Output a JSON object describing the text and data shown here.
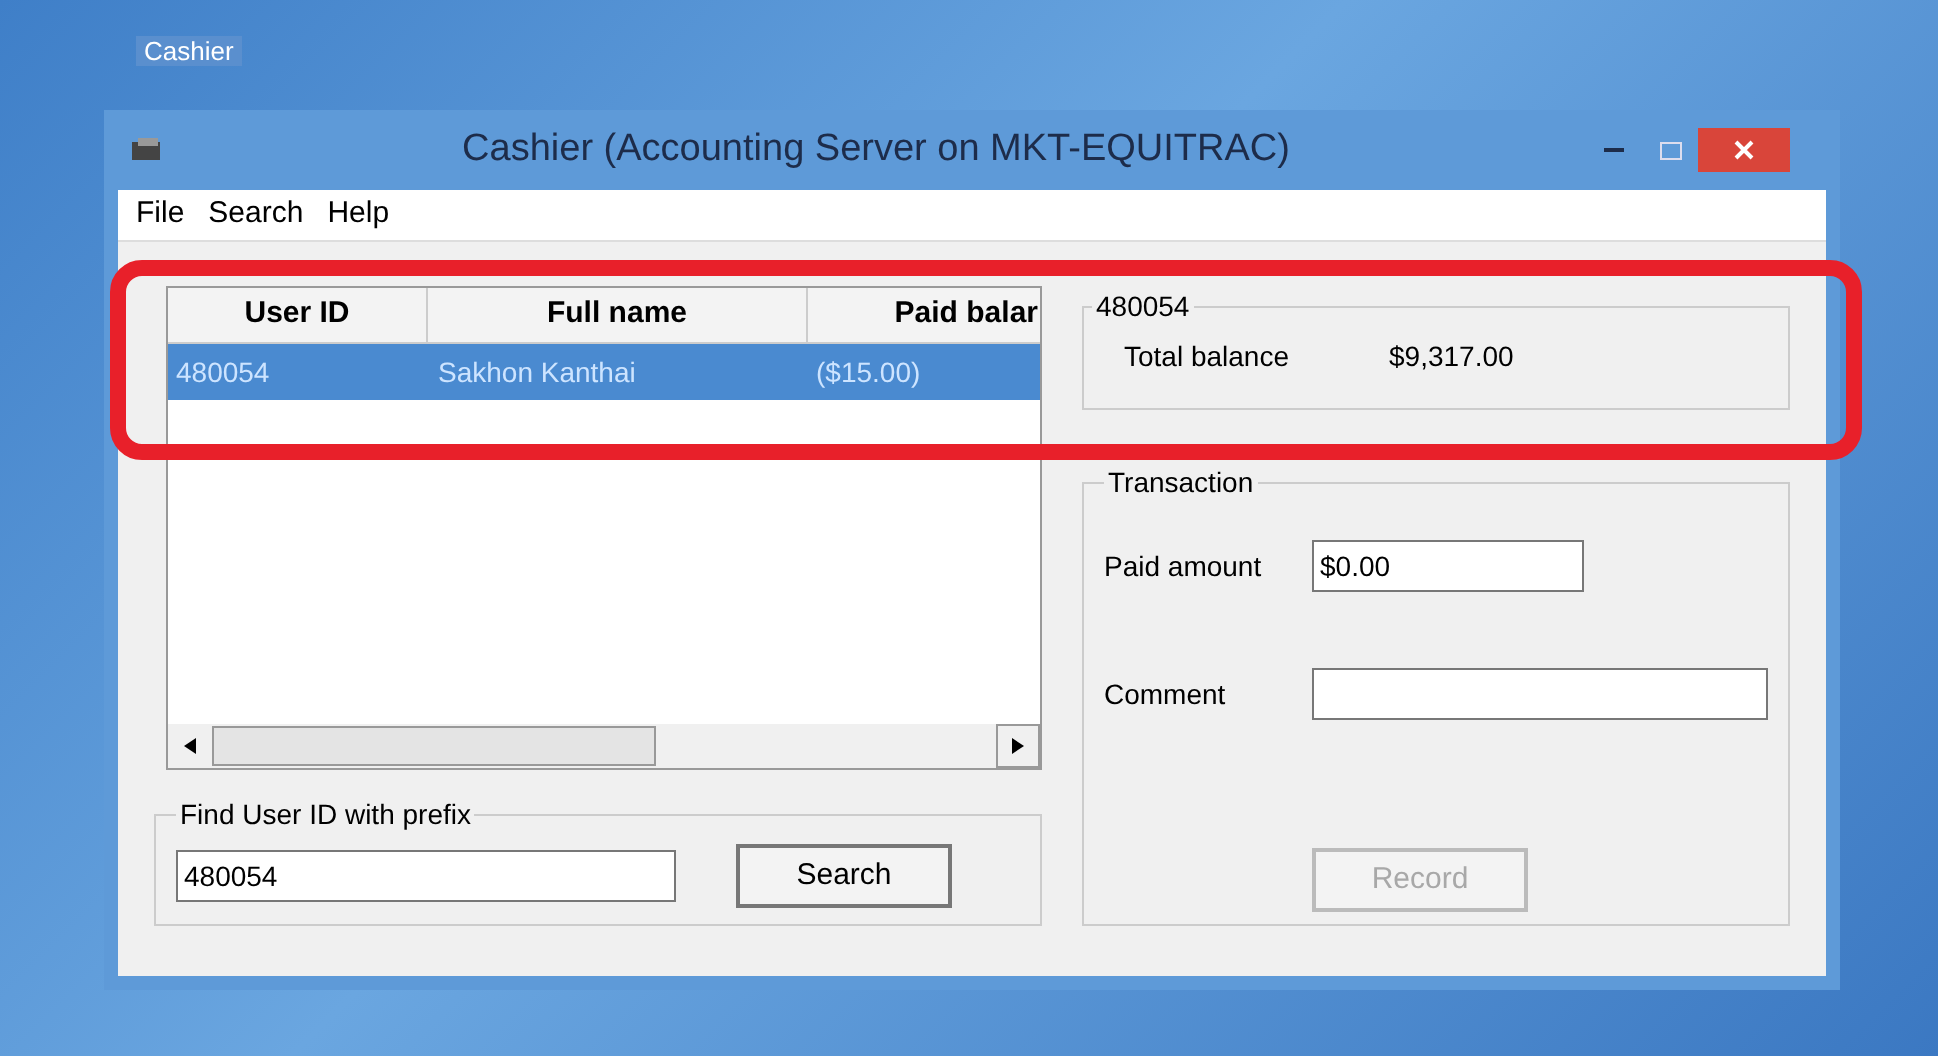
{
  "desktop": {
    "icon_label": "Cashier"
  },
  "window": {
    "title": "Cashier (Accounting Server on MKT-EQUITRAC)"
  },
  "menu": [
    "File",
    "Search",
    "Help"
  ],
  "user_table": {
    "columns": [
      "User ID",
      "Full name",
      "Paid balar"
    ],
    "rows": [
      {
        "cells": [
          "480054",
          "Sakhon Kanthai",
          "($15.00)"
        ],
        "selected": true
      }
    ]
  },
  "find": {
    "legend": "Find User ID with prefix",
    "value": "480054",
    "button": "Search"
  },
  "account": {
    "legend": "480054",
    "label": "Total balance",
    "value": "$9,317.00"
  },
  "transaction": {
    "legend": "Transaction",
    "paid_label": "Paid amount",
    "paid_value": "$0.00",
    "comment_label": "Comment",
    "record_button": {
      "label": "Record",
      "disabled": true
    }
  }
}
